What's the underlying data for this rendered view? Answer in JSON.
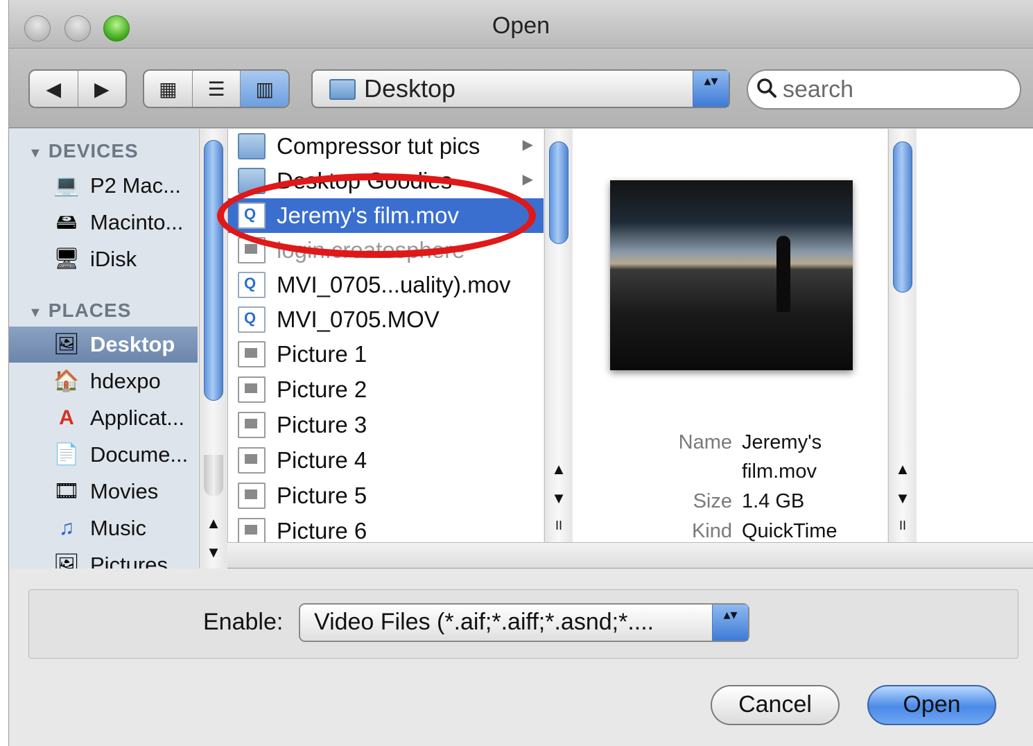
{
  "window": {
    "title": "Open"
  },
  "toolbar": {
    "back_glyph": "◀",
    "forward_glyph": "▶",
    "view_icon_glyph": "▦",
    "view_list_glyph": "☰",
    "view_column_glyph": "▥",
    "path_label": "Desktop",
    "stepper_glyph": "▴▾",
    "search_placeholder": "search"
  },
  "sidebar": {
    "devices_heading": "DEVICES",
    "places_heading": "PLACES",
    "devices": [
      {
        "label": "P2 Mac...",
        "icon": "laptop-icon",
        "glyph": "💻"
      },
      {
        "label": "Macinto...",
        "icon": "hard-drive-icon",
        "glyph": "🖴"
      },
      {
        "label": "iDisk",
        "icon": "idisk-icon",
        "glyph": "🖥"
      }
    ],
    "places": [
      {
        "label": "Desktop",
        "icon": "desktop-icon",
        "glyph": "🖼",
        "selected": true
      },
      {
        "label": "hdexpo",
        "icon": "home-icon",
        "glyph": "🏠"
      },
      {
        "label": "Applicat...",
        "icon": "applications-icon",
        "glyph": "A"
      },
      {
        "label": "Docume...",
        "icon": "documents-icon",
        "glyph": "📄"
      },
      {
        "label": "Movies",
        "icon": "movies-icon",
        "glyph": "🎞"
      },
      {
        "label": "Music",
        "icon": "music-icon",
        "glyph": "♫"
      },
      {
        "label": "Pictures",
        "icon": "pictures-icon",
        "glyph": "🖼"
      }
    ]
  },
  "files": [
    {
      "name": "Compressor tut pics",
      "kind": "folder",
      "has_children": true
    },
    {
      "name": "Desktop Goodies",
      "kind": "folder",
      "has_children": true
    },
    {
      "name": "Jeremy's film.mov",
      "kind": "movie",
      "selected": true
    },
    {
      "name": "login.createsphere",
      "kind": "document"
    },
    {
      "name": "MVI_0705...uality).mov",
      "kind": "movie"
    },
    {
      "name": "MVI_0705.MOV",
      "kind": "movie"
    },
    {
      "name": "Picture 1",
      "kind": "image"
    },
    {
      "name": "Picture 2",
      "kind": "image"
    },
    {
      "name": "Picture 3",
      "kind": "image"
    },
    {
      "name": "Picture 4",
      "kind": "image"
    },
    {
      "name": "Picture 5",
      "kind": "image"
    },
    {
      "name": "Picture 6",
      "kind": "image"
    }
  ],
  "preview": {
    "name_key": "Name",
    "name_value_line1": "Jeremy's",
    "name_value_line2": "film.mov",
    "size_key": "Size",
    "size_value": "1.4 GB",
    "kind_key": "Kind",
    "kind_value": "QuickTime"
  },
  "scroll": {
    "up_glyph": "▲",
    "down_glyph": "▼",
    "grip_glyph": "II"
  },
  "bottom": {
    "enable_label": "Enable:",
    "enable_value": "Video Files (*.aif;*.aiff;*.asnd;*....",
    "cancel_label": "Cancel",
    "open_label": "Open"
  },
  "colors": {
    "selection": "#3a6fd0",
    "annotation": "#e01818",
    "zoom_button": "#3aa71a"
  }
}
